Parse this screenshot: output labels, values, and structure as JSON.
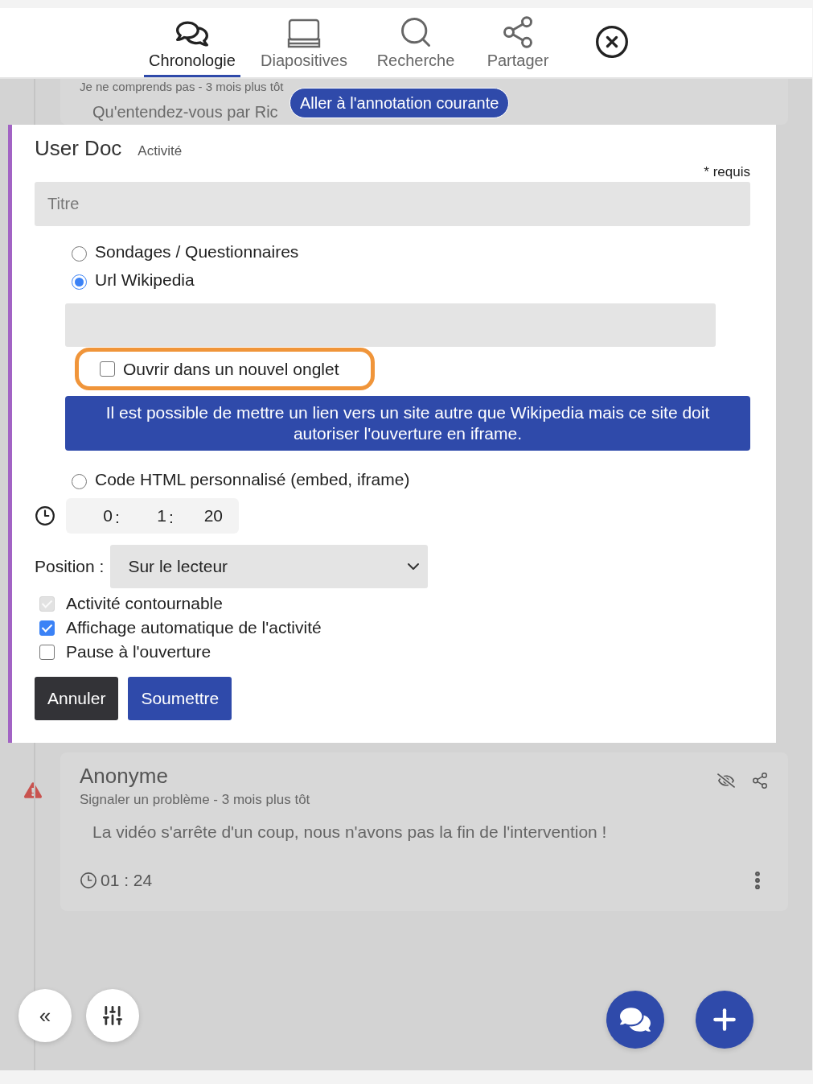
{
  "tabs": [
    {
      "label": "Chronologie",
      "selected": true
    },
    {
      "label": "Diapositives",
      "selected": false
    },
    {
      "label": "Recherche",
      "selected": false
    },
    {
      "label": "Partager",
      "selected": false
    }
  ],
  "jump_button": "Aller à l'annotation courante",
  "background_card": {
    "meta": "Je ne comprends pas - 3 mois plus tôt",
    "text": "Qu'entendez-vous par Ric"
  },
  "form": {
    "title": "User Doc",
    "subtitle": "Activité",
    "required_note": "* requis",
    "title_field": {
      "placeholder": "Titre"
    },
    "options": [
      {
        "label": "Sondages / Questionnaires",
        "selected": false
      },
      {
        "label": "Url Wikipedia",
        "selected": true,
        "details": {
          "new_tab": {
            "label": "Ouvrir dans un nouvel onglet",
            "checked": false,
            "highlighted": true
          },
          "info": "Il est possible de mettre un lien vers un site autre que Wikipedia mais ce site doit autoriser l'ouverture en iframe."
        }
      },
      {
        "label": "Code HTML personnalisé (embed, iframe)",
        "selected": false
      }
    ],
    "time": {
      "hours": "0",
      "minutes": "1",
      "seconds": "20",
      "separators": [
        ":",
        ":"
      ]
    },
    "position": {
      "label": "Position :",
      "value": "Sur le lecteur"
    },
    "checkboxes": [
      {
        "label": "Activité contournable",
        "checked": true,
        "disabled": true
      },
      {
        "label": "Affichage automatique de l'activité",
        "checked": true,
        "disabled": false
      },
      {
        "label": "Pause à l'ouverture",
        "checked": false,
        "disabled": false
      }
    ],
    "buttons": [
      {
        "label": "Annuler",
        "kind": "cancel"
      },
      {
        "label": "Soumettre",
        "kind": "submit"
      }
    ]
  },
  "annotation": {
    "author": "Anonyme",
    "meta": "Signaler un problème - 3 mois plus tôt",
    "text": "La vidéo s'arrête d'un coup, nous n'avons pas la fin de l'intervention !",
    "time": "01 : 24"
  },
  "bottom_left_buttons": [
    {
      "label": "«",
      "kind": "collapse"
    },
    {
      "kind": "filters"
    }
  ],
  "bottom_right_buttons": [
    {
      "kind": "comments"
    },
    {
      "kind": "add"
    }
  ]
}
